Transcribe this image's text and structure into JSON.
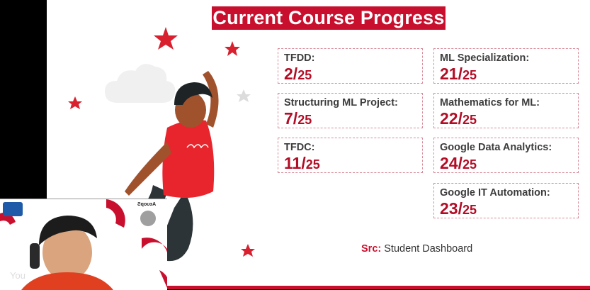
{
  "slide": {
    "title": "Current Course Progress",
    "courses": [
      {
        "label": "TFDD:",
        "done": "2/",
        "total": "25"
      },
      {
        "label": "Structuring ML Project:",
        "done": "7/",
        "total": "25"
      },
      {
        "label": "TFDC:",
        "done": "11/",
        "total": "25"
      },
      {
        "label": "ML Specialization:",
        "done": "21/",
        "total": "25"
      },
      {
        "label": "Mathematics for ML:",
        "done": "22/",
        "total": "25"
      },
      {
        "label": "Google Data Analytics:",
        "done": "24/",
        "total": "25"
      },
      {
        "label": "Google IT Automation:",
        "done": "23/",
        "total": "25"
      }
    ],
    "source_key": "Src:",
    "source_value": " Student Dashboard"
  },
  "video": {
    "participant_label": "You",
    "right_logo_text": "ƧqoυэA"
  },
  "colors": {
    "accent": "#c8102e",
    "value": "#b30d26"
  }
}
